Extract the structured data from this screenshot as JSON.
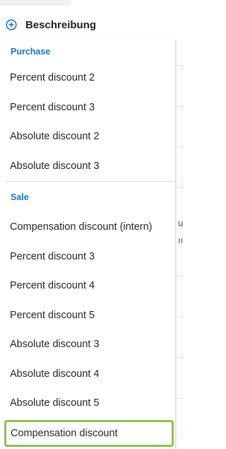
{
  "header": {
    "title": "Beschreibung",
    "add_icon": "plus-circle-icon"
  },
  "dropdown": {
    "groups": [
      {
        "label": "Purchase",
        "items": [
          "Percent discount 2",
          "Percent discount 3",
          "Absolute discount 2",
          "Absolute discount 3"
        ]
      },
      {
        "label": "Sale",
        "items": [
          "Compensation discount (intern)",
          "Percent discount 3",
          "Percent discount 4",
          "Percent discount 5",
          "Absolute discount 3",
          "Absolute discount 4",
          "Absolute discount 5",
          "Compensation discount"
        ]
      }
    ],
    "selected_item": "Compensation discount"
  },
  "colors": {
    "group_header": "#1a73c8",
    "selection_border": "#8cc152",
    "add_icon": "#1a73c8"
  }
}
